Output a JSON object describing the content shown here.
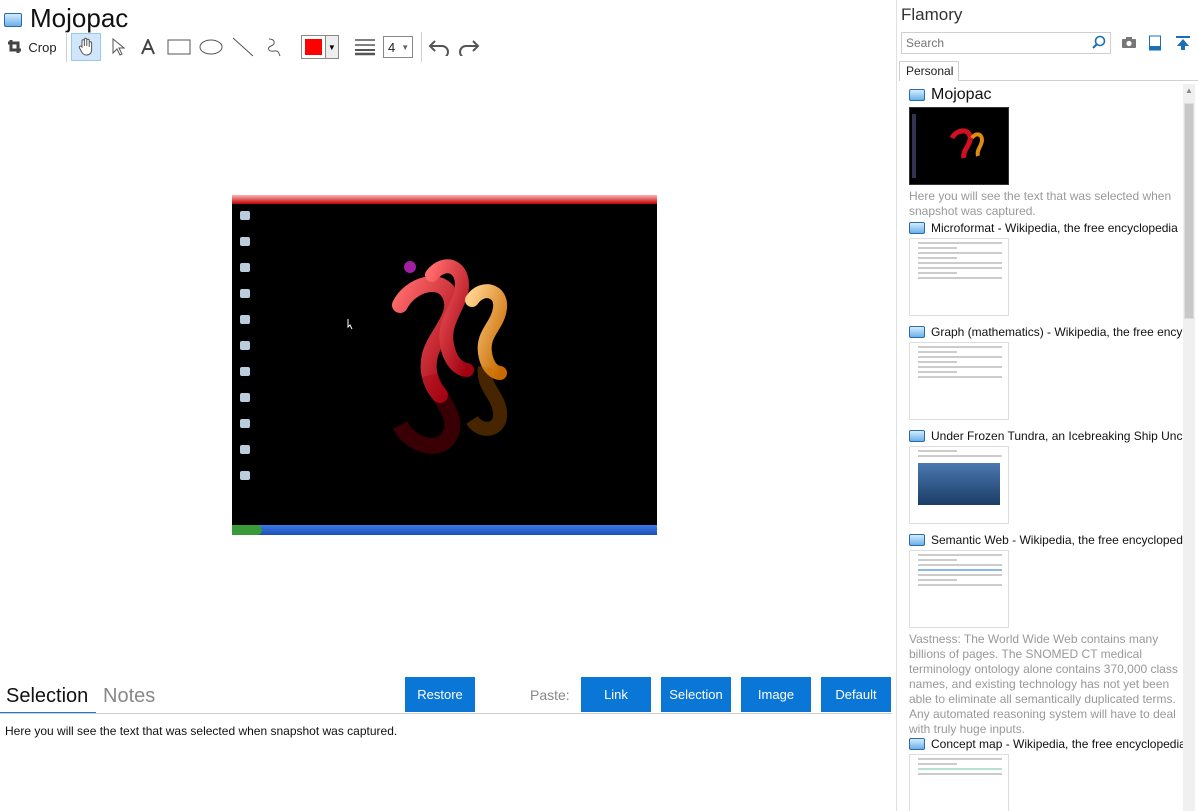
{
  "editor": {
    "title": "Mojopac",
    "toolbar": {
      "crop_label": "Crop",
      "tools": [
        "hand-icon",
        "arrow-icon",
        "text-icon",
        "rectangle-icon",
        "ellipse-icon",
        "line-icon",
        "freehand-icon"
      ],
      "color": "#ff0000",
      "line_width": "4",
      "undo": "undo-icon",
      "redo": "redo-icon"
    },
    "tabs": {
      "selection": "Selection",
      "notes": "Notes"
    },
    "buttons": {
      "restore": "Restore",
      "paste_label": "Paste:",
      "link": "Link",
      "selection": "Selection",
      "image": "Image",
      "default": "Default"
    },
    "selection_text": "Here you will see the text that was selected when snapshot was captured."
  },
  "sidebar": {
    "title": "Flamory",
    "search_placeholder": "Search",
    "tab": "Personal",
    "items": [
      {
        "title": "Mojopac",
        "desc": "Here you will see the text that was selected when snapshot was captured."
      },
      {
        "title": "Microformat - Wikipedia, the free encyclopedia"
      },
      {
        "title": "Graph (mathematics) - Wikipedia, the free ency"
      },
      {
        "title": "Under Frozen Tundra, an Icebreaking Ship Unco"
      },
      {
        "title": "Semantic Web - Wikipedia, the free encycloped",
        "desc": "Vastness: The World Wide Web contains many billions of pages. The SNOMED CT medical terminology ontology alone contains 370,000 class names, and existing technology has not yet been able to eliminate all semantically duplicated terms. Any automated reasoning system will have to deal with truly huge inputs."
      },
      {
        "title": "Concept map - Wikipedia, the free encyclopedia"
      }
    ]
  },
  "colors": {
    "accent": "#0a76d6"
  }
}
